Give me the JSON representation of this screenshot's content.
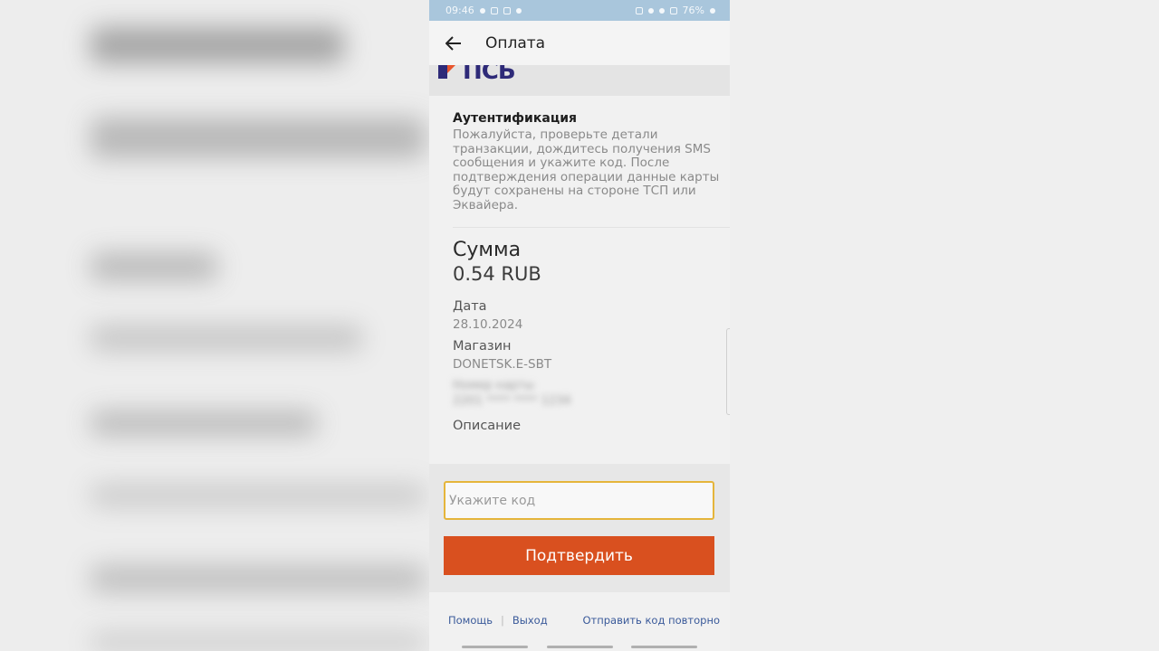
{
  "status_bar": {
    "time": "09:46",
    "battery": "76%"
  },
  "app_bar": {
    "title": "Оплата",
    "back_icon": "arrow-left-icon"
  },
  "bank": {
    "logo_text": "ПСБ",
    "brand_color": "#2e2a78",
    "accent_color": "#e8542c"
  },
  "auth": {
    "title": "Аутентификация",
    "text": "Пожалуйста, проверьте детали транзакции, дождитесь получения SMS сообщения и укажите код. После подтверждения операции данные карты будут сохранены на стороне ТСП или Эквайера."
  },
  "payment": {
    "sum_label": "Сумма",
    "sum_value": "0.54 RUB",
    "date_label": "Дата",
    "date_value": "28.10.2024",
    "shop_label": "Магазин",
    "shop_value": "DONETSK.E-SBT",
    "card_label": "Номер карты",
    "card_value": "2201 **** **** 1234",
    "description_label": "Описание"
  },
  "form": {
    "code_placeholder": "Укажите код",
    "code_value": "",
    "confirm_label": "Подтвердить",
    "confirm_color": "#d9501f",
    "input_border_color": "#e5b53b"
  },
  "footer": {
    "help_label": "Помощь",
    "exit_label": "Выход",
    "resend_label": "Отправить код повторно"
  }
}
